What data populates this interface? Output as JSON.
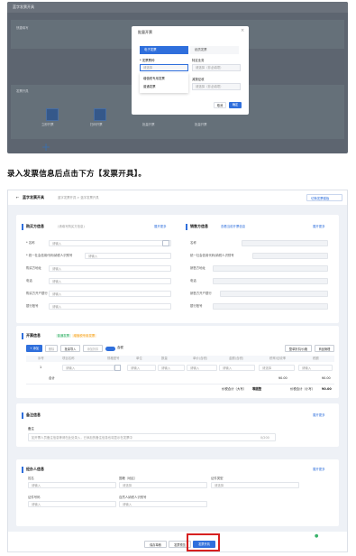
{
  "top": {
    "app_title": "蓝字发票开具",
    "section_a": "快捷填写",
    "section_b": "发票开具",
    "features": [
      "立即开票",
      "扫码开票",
      "批量开票",
      "批量开票"
    ],
    "dialog": {
      "title": "批量开票",
      "tab_active": "电子发票",
      "tab_other": "纸质发票",
      "field1_label": "* 发票票种",
      "field1_placeholder": "请选择",
      "field2_label": "特定业务",
      "field2_placeholder": "请选择（非必填项）",
      "opt1": "增值税专用发票",
      "opt2": "普通发票",
      "field3_label": "减按征收",
      "field3_placeholder": "请选择（非必填项）",
      "cancel": "取消",
      "ok": "确定"
    }
  },
  "caption": "录入发票信息后点击下方【发票开具】。",
  "page": {
    "back_title": "蓝字发票开具",
    "breadcrumb": "蓝字发票开具  >  蓝字发票开具",
    "top_right_link": "切换发票模板",
    "buyer": {
      "title": "购买方信息",
      "hint": "(请填写购买方信息)",
      "expand": "展开更多",
      "fields": [
        "* 名称",
        "* 统一社会信用代码/纳税人识别号",
        "购买方地址",
        "电话",
        "购买方开户银行",
        "银行账号"
      ],
      "placeholders": [
        "请输入",
        "请输入",
        "请输入",
        "请输入",
        "请输入",
        "请输入"
      ]
    },
    "seller": {
      "title": "销售方信息",
      "hint": "查看当前开票信息",
      "expand": "展开更多",
      "fields": [
        "名称",
        "统一社会信用代码/纳税人识别号",
        "销售方地址",
        "电话",
        "销售方开户银行",
        "银行账号"
      ]
    },
    "items": {
      "title": "开票信息",
      "tag1": "普通发票",
      "tag2": "增值税专用发票",
      "btn_add": "+ 添加",
      "btn_del": "删除",
      "btn_import": "批量导入",
      "btn_discount": "添加折扣",
      "toggle": "含税",
      "btn_right1": "整单折扣/价格",
      "btn_right2": "商品管理",
      "headers": [
        "序号",
        "项目名称",
        "规格型号",
        "单位",
        "数量",
        "单价(含税)",
        "金额(含税)",
        "税率/征收率",
        "税额"
      ],
      "row_index": "1",
      "row_placeholders": [
        "请输入",
        "请输入",
        "请输入",
        "请输入",
        "请输入",
        "请选择",
        "请输入"
      ],
      "total_label": "合计",
      "total_amount": "¥0.00",
      "total_tax": "¥0.00",
      "grand_total_label": "价税合计（大写）",
      "grand_total_caps": "零圆整",
      "grand_total_small_label": "价税合计（小写）",
      "grand_total_small": "¥0.00"
    },
    "remarks": {
      "title": "备注信息",
      "expand": "展开更多",
      "label": "备注",
      "placeholder": "如开票人员备注信息等请在此处录入，已添加的备注信息也将显示在发票中",
      "counter": "0/200"
    },
    "handler": {
      "title": "经办人信息",
      "expand": "展开更多",
      "labels": [
        "姓名",
        "国籍（地区）",
        "证件类型",
        "证件号码",
        "自然人纳税人识别号"
      ],
      "placeholders": [
        "请输入",
        "请选择",
        "请选择",
        "请输入",
        "请输入"
      ]
    },
    "footer": {
      "btn1": "保存草稿",
      "btn2": "发票预览",
      "btn3": "发票开具"
    }
  },
  "colors": {
    "accent": "#2f6fdc",
    "highlight": "#d62020",
    "tag_green": "#38b26a",
    "tag_orange": "#f5a623"
  }
}
